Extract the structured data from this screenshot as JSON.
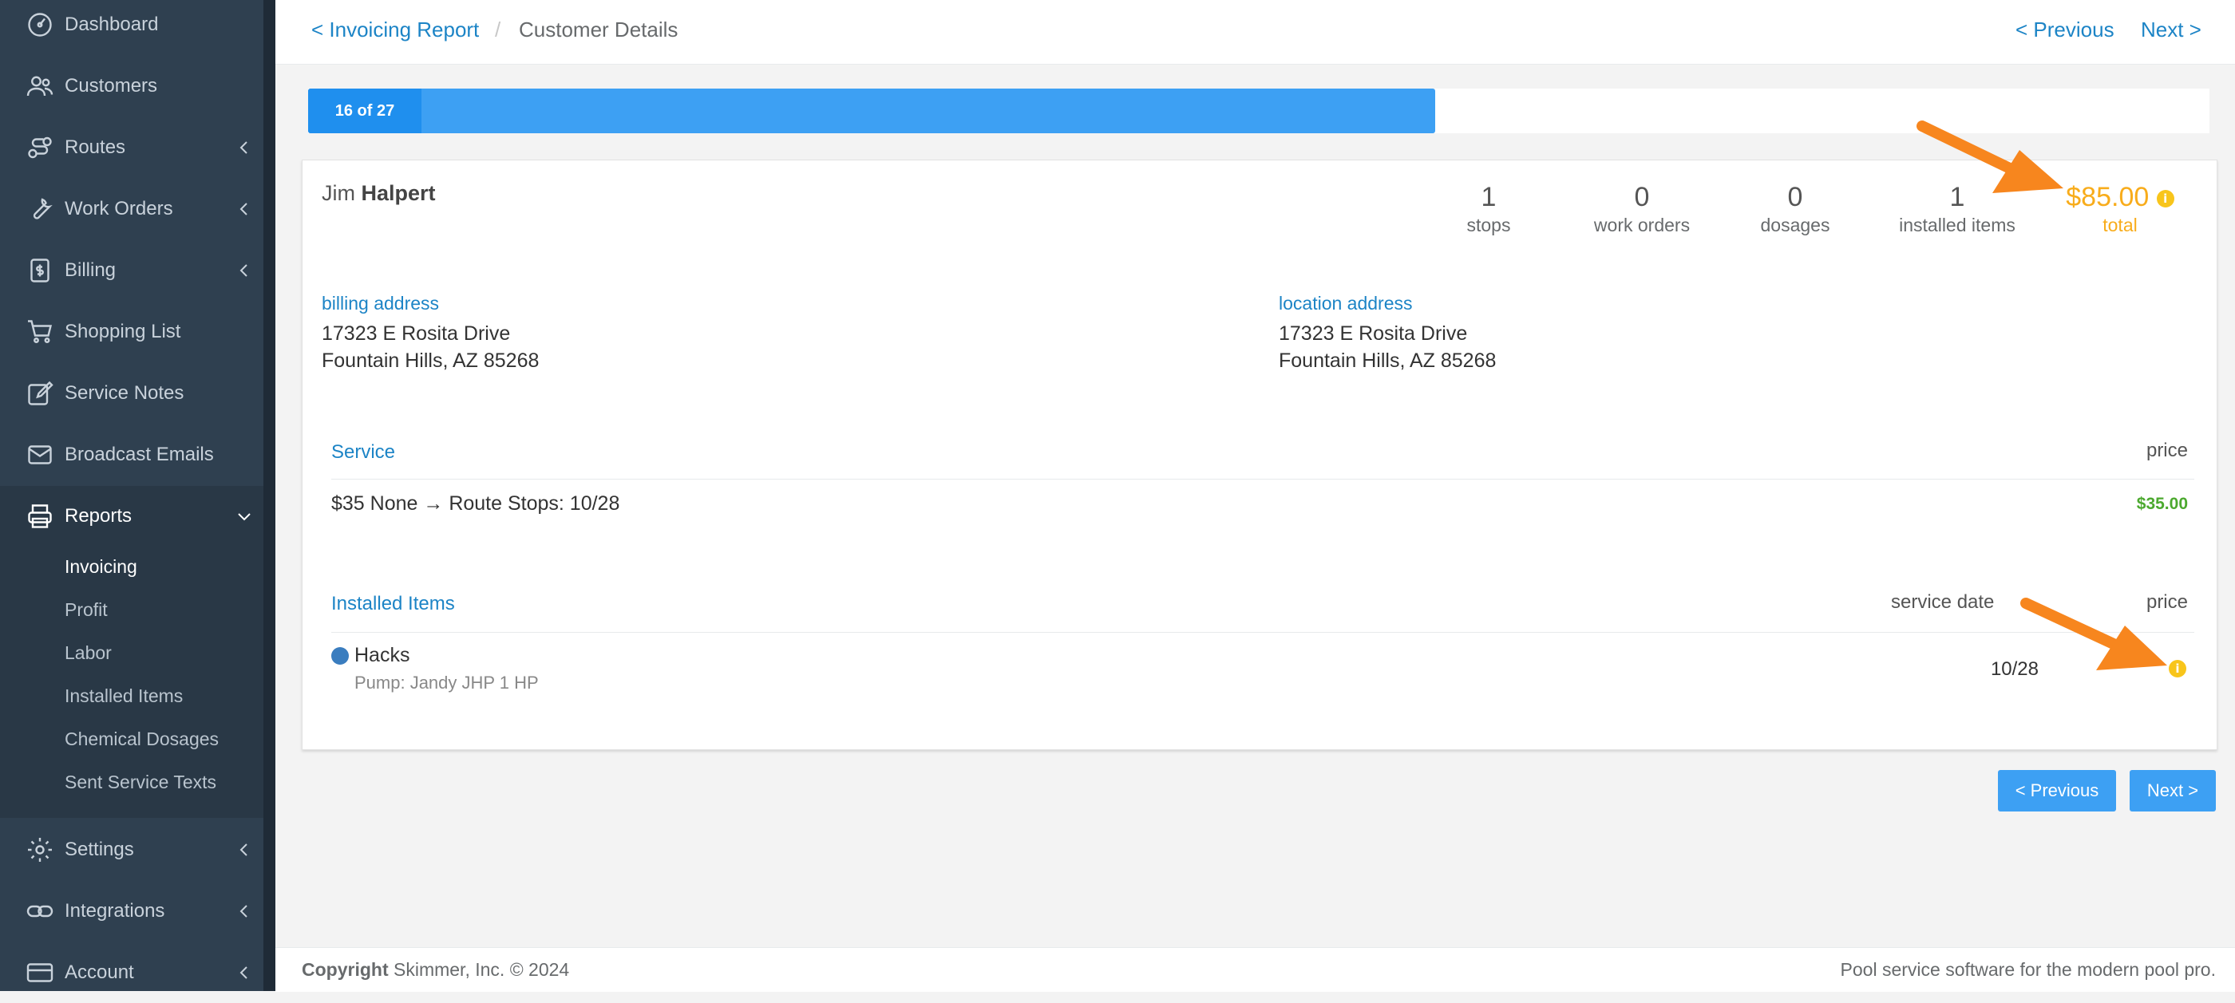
{
  "sidebar": {
    "items": [
      {
        "label": "Dashboard",
        "icon": "dashboard-icon"
      },
      {
        "label": "Customers",
        "icon": "customers-icon"
      },
      {
        "label": "Routes",
        "icon": "routes-icon"
      },
      {
        "label": "Work Orders",
        "icon": "wrench-icon"
      },
      {
        "label": "Billing",
        "icon": "billing-icon"
      },
      {
        "label": "Shopping List",
        "icon": "cart-icon"
      },
      {
        "label": "Service Notes",
        "icon": "edit-icon"
      },
      {
        "label": "Broadcast Emails",
        "icon": "envelope-icon"
      },
      {
        "label": "Reports",
        "icon": "printer-icon"
      },
      {
        "label": "Settings",
        "icon": "gear-icon"
      },
      {
        "label": "Integrations",
        "icon": "link-icon"
      },
      {
        "label": "Account",
        "icon": "card-icon"
      }
    ],
    "reports_submenu": [
      "Invoicing",
      "Profit",
      "Labor",
      "Installed Items",
      "Chemical Dosages",
      "Sent Service Texts"
    ]
  },
  "header": {
    "back_link": "< Invoicing Report",
    "separator": "/",
    "current": "Customer Details",
    "prev": "< Previous",
    "next": "Next >"
  },
  "progress": {
    "label": "16 of 27",
    "current": 16,
    "total": 27
  },
  "customer": {
    "first_name": "Jim",
    "last_name": "Halpert",
    "stats": [
      {
        "value": "1",
        "label": "stops"
      },
      {
        "value": "0",
        "label": "work orders"
      },
      {
        "value": "0",
        "label": "dosages"
      },
      {
        "value": "1",
        "label": "installed items"
      }
    ],
    "total": {
      "value": "$85.00",
      "label": "total"
    },
    "billing_address": {
      "label": "billing address",
      "line1": "17323 E Rosita Drive",
      "line2": "Fountain Hills, AZ 85268"
    },
    "location_address": {
      "label": "location address",
      "line1": "17323 E Rosita Drive",
      "line2": "Fountain Hills, AZ 85268"
    }
  },
  "service_table": {
    "header": "Service",
    "price_header": "price",
    "row": {
      "description": "$35 None → Route Stops: 10/28",
      "price": "$35.00"
    }
  },
  "installed_table": {
    "header": "Installed Items",
    "date_header": "service date",
    "price_header": "price",
    "row": {
      "name": "Hacks",
      "description": "Pump: Jandy JHP 1 HP",
      "date": "10/28"
    }
  },
  "buttons": {
    "prev": "< Previous",
    "next": "Next >"
  },
  "footer": {
    "copyright_bold": "Copyright",
    "copyright_text": "Skimmer, Inc. © 2024",
    "tagline": "Pool service software for the modern pool pro."
  },
  "colors": {
    "sidebar": "#2f4050",
    "accent": "#1c84c6",
    "button": "#3da0f3",
    "total": "#f8ac1b",
    "price_green": "#4ca92f",
    "arrow": "#f7861e"
  }
}
